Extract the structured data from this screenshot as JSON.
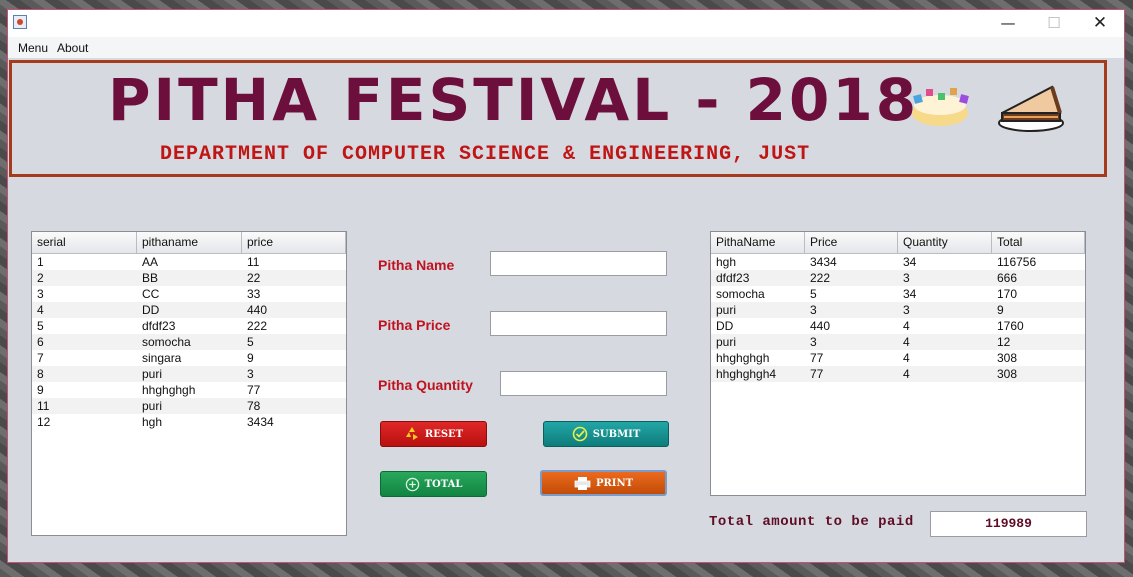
{
  "window": {
    "minimize_glyph": "—",
    "maximize_glyph": "☐",
    "close_glyph": "✕"
  },
  "menubar": {
    "items": [
      "Menu",
      "About"
    ]
  },
  "banner": {
    "title": "PITHA FESTIVAL - 2018",
    "subtitle": "DEPARTMENT OF COMPUTER SCIENCE & ENGINEERING, JUST",
    "title_color": "#6d0f3c",
    "subtitle_color": "#c01515",
    "border_color": "#a63a1c"
  },
  "left_table": {
    "columns": [
      "serial",
      "pithaname",
      "price"
    ],
    "rows": [
      [
        "1",
        "AA",
        "11"
      ],
      [
        "2",
        "BB",
        "22"
      ],
      [
        "3",
        "CC",
        "33"
      ],
      [
        "4",
        "DD",
        "440"
      ],
      [
        "5",
        "dfdf23",
        "222"
      ],
      [
        "6",
        "somocha",
        "5"
      ],
      [
        "7",
        "singara",
        "9"
      ],
      [
        "8",
        "puri",
        "3"
      ],
      [
        "9",
        "hhghghgh",
        "77"
      ],
      [
        "11",
        "puri",
        "78"
      ],
      [
        "12",
        "hgh",
        "3434"
      ]
    ]
  },
  "form": {
    "name_label": "Pitha Name",
    "price_label": "Pitha Price",
    "quantity_label": "Pitha Quantity",
    "name_value": "",
    "price_value": "",
    "quantity_value": "",
    "label_color": "#c0121f"
  },
  "buttons": {
    "reset": "RESET",
    "submit": "SUBMIT",
    "total": "TOTAL",
    "print": "PRINT",
    "reset_icon": "recycle-icon",
    "submit_icon": "check-circle-icon",
    "total_icon": "plus-circle-icon",
    "print_icon": "printer-icon"
  },
  "right_table": {
    "columns": [
      "PithaName",
      "Price",
      "Quantity",
      "Total"
    ],
    "rows": [
      [
        "hgh",
        "3434",
        "34",
        "116756"
      ],
      [
        "dfdf23",
        "222",
        "3",
        "666"
      ],
      [
        "somocha",
        "5",
        "34",
        "170"
      ],
      [
        "puri",
        "3",
        "3",
        "9"
      ],
      [
        "DD",
        "440",
        "4",
        "1760"
      ],
      [
        "puri",
        "3",
        "4",
        "12"
      ],
      [
        "hhghghgh",
        "77",
        "4",
        "308"
      ],
      [
        "hhghghgh4",
        "77",
        "4",
        "308"
      ]
    ]
  },
  "summary": {
    "total_label": "Total amount to be paid",
    "total_value": "119989"
  }
}
